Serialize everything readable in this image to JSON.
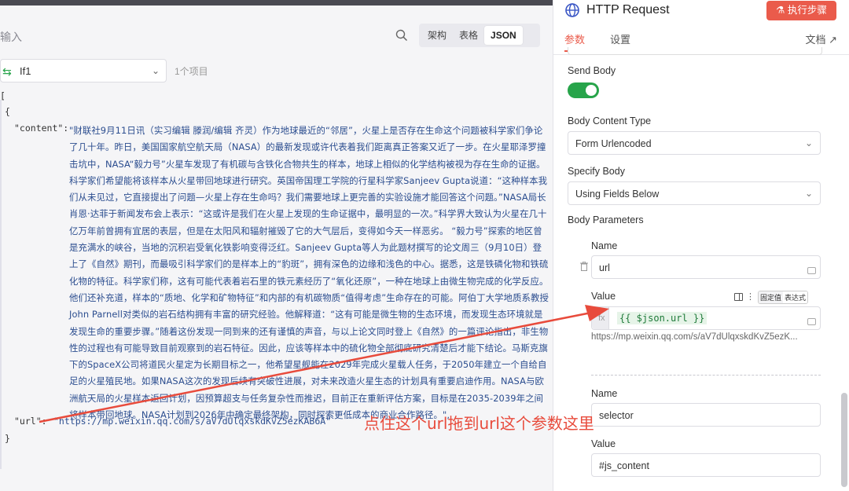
{
  "left": {
    "input_label": "输入",
    "view_tabs": [
      "架构",
      "表格",
      "JSON"
    ],
    "active_view": "JSON",
    "item_select": "If1",
    "item_count": "1个项目",
    "json": {
      "content_key": "\"content\":",
      "content_value": "\"财联社9月11日讯（实习编辑 滕润/编辑 齐灵）作为地球最近的“邻居”，火星上是否存在生命这个问题被科学家们争论了几十年。昨日，美国国家航空航天局（NASA）的最新发现或许代表着我们距离真正答案又近了一步。在火星耶泽罗撞击坑中，NASA“毅力号”火星车发现了有机碳与含铁化合物共生的样本，地球上相似的化学结构被视为存在生命的证据。科学家们希望能将该样本从火星带回地球进行研究。英国帝国理工学院的行星科学家Sanjeev Gupta说道：“这种样本我们从未见过，它直接提出了问题—火星上存在生命吗？我们需要地球上更完善的实验设施才能回答这个问题。”NASA局长肖恩·达菲于新闻发布会上表示：“这或许是我们在火星上发现的生命证据中，最明显的一次。”科学界大致认为火星在几十亿万年前曾拥有宜居的表层，但是在太阳风和辐射摧毁了它的大气层后，变得如今天一样恶劣。 “毅力号”探索的地区曾是充满水的峡谷，当地的沉积岩受氧化铁影响变得泛红。Sanjeev Gupta等人为此题材撰写的论文周三（9月10日）登上了《自然》期刊，而最吸引科学家们的是样本上的“豹斑”，拥有深色的边缘和浅色的中心。据悉，这是铁磷化物和铁硫化物的特征。科学家们称，这有可能代表着岩石里的铁元素经历了“氧化还原”，一种在地球上由微生物完成的化学反应。他们还补充道，样本的“质地、化学和矿物特征”和内部的有机碳物质“值得考虑”生命存在的可能。阿伯丁大学地质系教授John Parnell对类似的岩石结构拥有丰富的研究经验。他解释道：“这有可能是微生物的生态环境，而发现生态环境就是发现生命的重要步骤。”随着这份发现一同到来的还有谨慎的声音，与以上论文同时登上《自然》的一篇评论指出，非生物性的过程也有可能导致目前观察到的岩石特征。因此，应该等样本中的硫化物全部彻底研究清楚后才能下结论。马斯克旗下的SpaceX公司将道民火星定为长期目标之一，他希望星舰能在2029年完成火星载人任务，于2050年建立一个自给自足的火星殖民地。如果NASA这次的发现后续有突破性进展，对未来改造火星生态的计划具有重要启迪作用。NASA与欧洲航天局的火星样本返回计划，因预算超支与任务复杂性而推迟，目前正在重新评估方案，目标是在2035-2039年之间将样本带回地球。NASA计划到2026年中确定最终架构，同时探索更低成本的商业合作路径。\",",
      "url_key": "\"url\":",
      "url_value": "\"https://mp.weixin.qq.com/s/aV7dUlqxskdKvZ5ezKAB6A\""
    }
  },
  "right": {
    "title": "HTTP Request",
    "exec_button": "执行步骤",
    "tabs": [
      "参数",
      "设置"
    ],
    "doc_link": "文档",
    "send_body_label": "Send Body",
    "send_body_on": true,
    "body_content_type_label": "Body Content Type",
    "body_content_type_value": "Form Urlencoded",
    "specify_body_label": "Specify Body",
    "specify_body_value": "Using Fields Below",
    "body_parameters_label": "Body Parameters",
    "param1": {
      "name_label": "Name",
      "name_value": "url",
      "value_label": "Value",
      "value_expr": "{{ $json.url }}",
      "value_result": "https://mp.weixin.qq.com/s/aV7dUlqxskdKvZ5ezK...",
      "mode_fixed": "固定值",
      "mode_expr": "表达式"
    },
    "param2": {
      "name_label": "Name",
      "name_value": "selector",
      "value_label": "Value",
      "value_value": "#js_content"
    }
  },
  "annotation": "点住这个url拖到url这个参数这里",
  "colors": {
    "accent": "#ea5b4b",
    "toggle": "#27a44a",
    "json_string": "#2b4d8f",
    "annotation": "#e84b3c"
  }
}
